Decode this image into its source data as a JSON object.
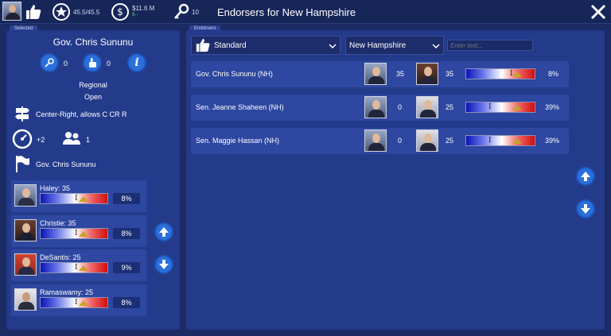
{
  "topbar": {
    "title": "Endorsers for New Hampshire",
    "ideology_score": "45.5/45.5",
    "money": "$11.6 M",
    "money_delta": "$--",
    "keys": "10"
  },
  "selected_panel": {
    "tab_label": "Selected",
    "name": "Gov. Chris Sununu",
    "keys_count": "0",
    "clicks_count": "0",
    "region": "Regional",
    "status": "Open",
    "ideology": "Center-Right, allows C CR R",
    "speed_bonus": "+2",
    "followers": "1",
    "endorsed_by": "Gov. Chris Sununu",
    "candidates": [
      {
        "label": "Haley: 35",
        "pct": "8%"
      },
      {
        "label": "Christie: 35",
        "pct": "8%"
      },
      {
        "label": "DeSantis: 25",
        "pct": "9%"
      },
      {
        "label": "Ramaswamy: 25",
        "pct": "8%"
      }
    ]
  },
  "endorsers_panel": {
    "tab_label": "Endorsers",
    "type_select": "Standard",
    "state_select": "New Hampshire",
    "search_placeholder": "Enter text...",
    "rows": [
      {
        "name": "Gov. Chris Sununu (NH)",
        "v1": "35",
        "v2": "35",
        "pct": "8%"
      },
      {
        "name": "Sen. Jeanne Shaheen (NH)",
        "v1": "0",
        "v2": "25",
        "pct": "39%"
      },
      {
        "name": "Sen. Maggie Hassan (NH)",
        "v1": "0",
        "v2": "25",
        "pct": "39%"
      }
    ]
  },
  "colors": {
    "background": "#1b2b63",
    "panel": "#243b8c",
    "accent_button": "#2a6fdc"
  }
}
